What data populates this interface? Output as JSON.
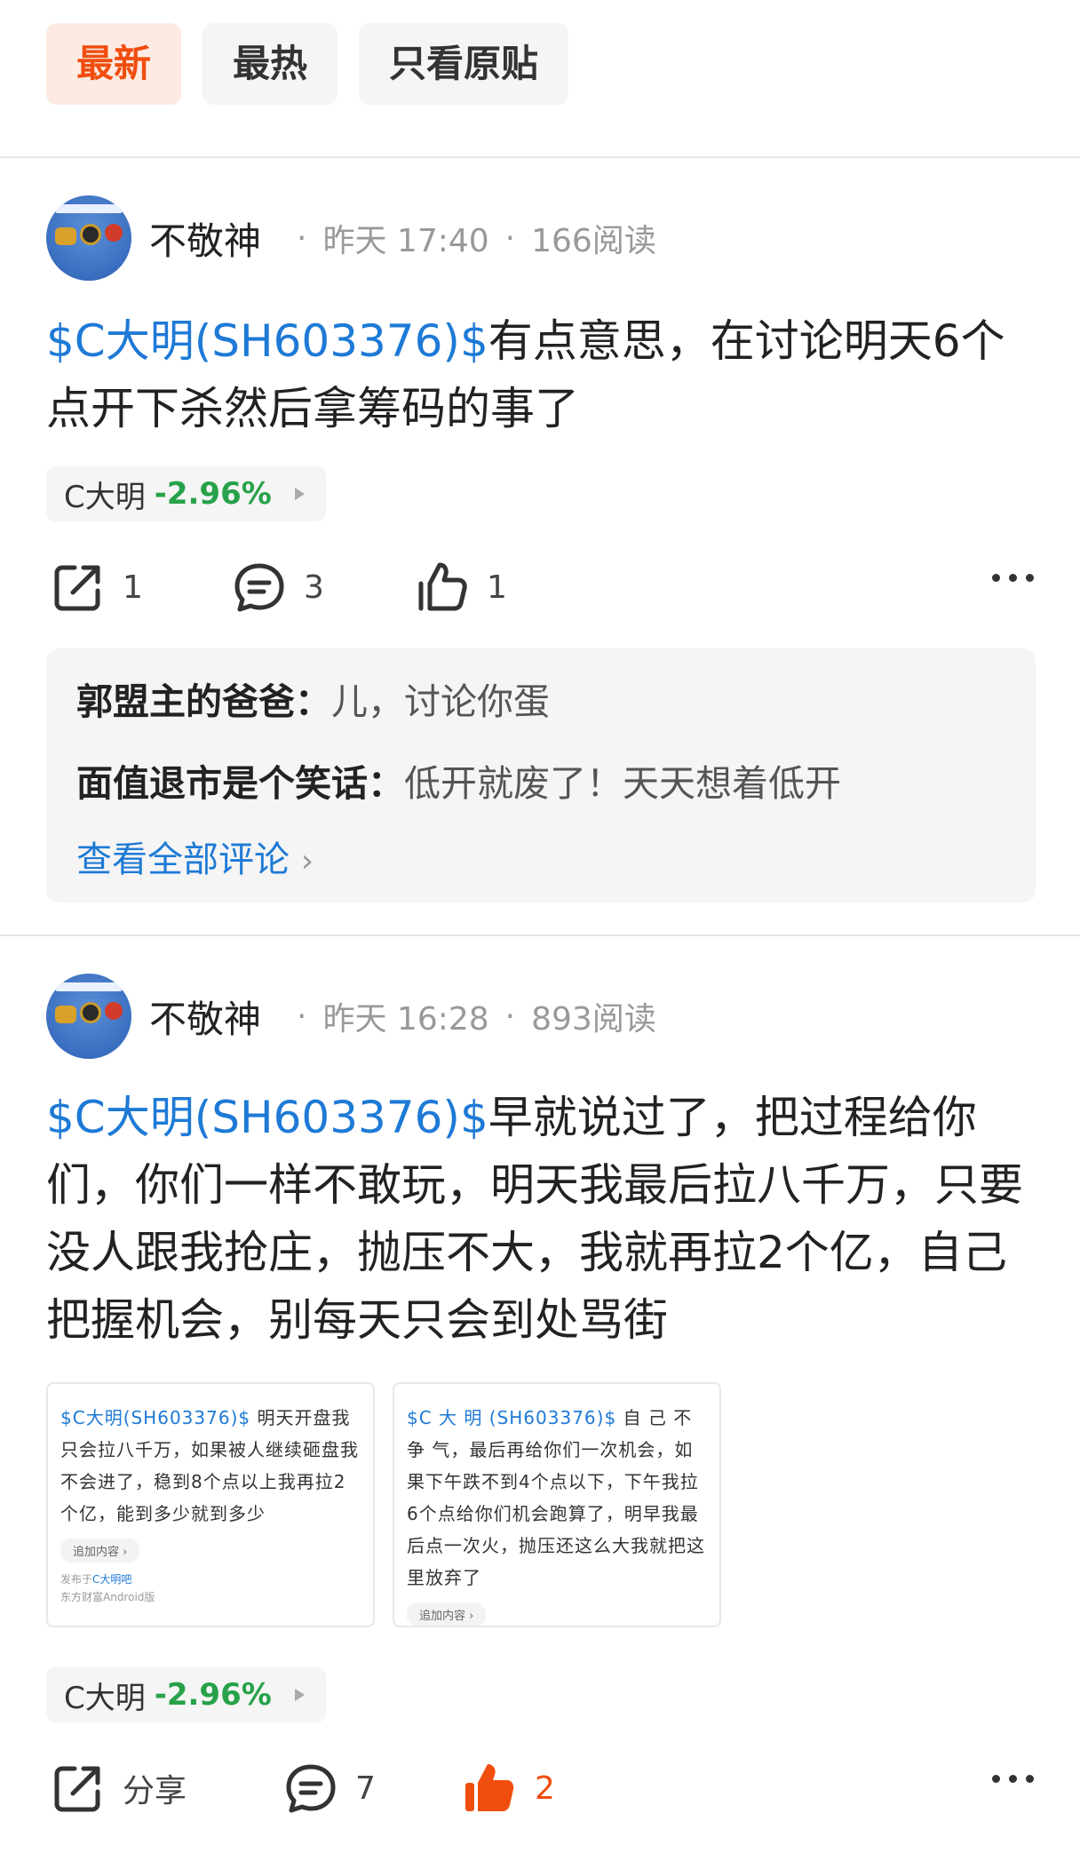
{
  "tabs": [
    {
      "label": "最新",
      "active": true
    },
    {
      "label": "最热",
      "active": false
    },
    {
      "label": "只看原贴",
      "active": false
    }
  ],
  "posts": [
    {
      "author": "不敬神",
      "time": "昨天 17:40",
      "reads": "166阅读",
      "stock_link": "$C大明(SH603376)$",
      "text": "有点意思，在讨论明天6个点开下杀然后拿筹码的事了",
      "stock_chip": {
        "name": "C大明",
        "change": "-2.96%"
      },
      "share_count": "1",
      "comment_count": "3",
      "like_count": "1",
      "comments": [
        {
          "user": "郭盟主的爸爸：",
          "text": "儿，讨论你蛋"
        },
        {
          "user": "面值退市是个笑话：",
          "text": "低开就废了！天天想着低开"
        }
      ],
      "view_all": "查看全部评论"
    },
    {
      "author": "不敬神",
      "time": "昨天 16:28",
      "reads": "893阅读",
      "stock_link": "$C大明(SH603376)$",
      "text": "早就说过了，把过程给你们，你们一样不敢玩，明天我最后拉八千万，只要没人跟我抢庄，抛压不大，我就再拉2个亿，自己把握机会，别每天只会到处骂街",
      "images": [
        {
          "link": "$C大明(SH603376)$",
          "text": " 明天开盘我只会拉八千万，如果被人继续砸盘我不会进了，稳到8个点以上我再拉2个亿，能到多少就到多少",
          "button": "追加内容 ›",
          "posted_prefix": "发布于",
          "posted_bar": "C大明吧",
          "client": "东方财富Android版"
        },
        {
          "link": "$C 大 明 (SH603376)$",
          "text": " 自 己 不 争 气，最后再给你们一次机会，如果下午跌不到4个点以下，下午我拉6个点给你们机会跑算了，明早我最后点一次火，抛压还这么大我就把这里放弃了",
          "button": "追加内容 ›"
        }
      ],
      "stock_chip": {
        "name": "C大明",
        "change": "-2.96%"
      },
      "share_label": "分享",
      "comment_count": "7",
      "like_count": "2"
    }
  ],
  "colors": {
    "accent": "#f04e0f",
    "link": "#1e7ad6",
    "down_green": "#27a24a"
  }
}
